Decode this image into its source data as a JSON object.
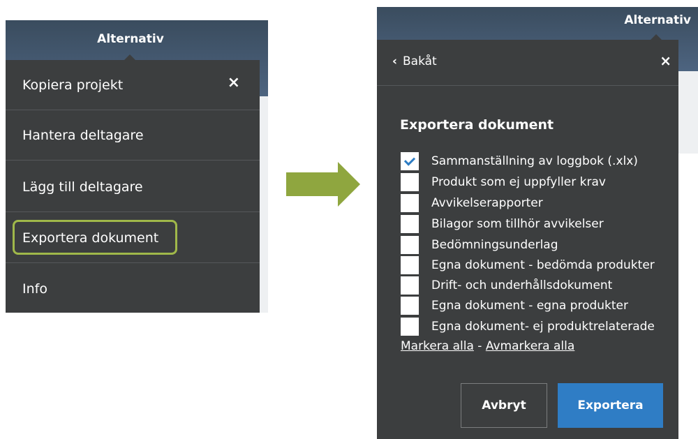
{
  "left": {
    "header_title": "Alternativ",
    "close_glyph": "×",
    "menu_items": [
      {
        "label": "Kopiera projekt"
      },
      {
        "label": "Hantera deltagare"
      },
      {
        "label": "Lägg till deltagare"
      },
      {
        "label": "Exportera dokument",
        "highlighted": true
      },
      {
        "label": "Info"
      }
    ]
  },
  "arrow": {
    "color": "#8fa63f"
  },
  "right": {
    "header_title": "Alternativ",
    "back_chevron": "‹",
    "back_label": "Bakåt",
    "close_glyph": "×",
    "section_title": "Exportera dokument",
    "options": [
      {
        "label": "Sammanställning av loggbok (.xlx)",
        "checked": true
      },
      {
        "label": "Produkt som ej uppfyller krav",
        "checked": false
      },
      {
        "label": "Avvikelserapporter",
        "checked": false
      },
      {
        "label": "Bilagor som tillhör avvikelser",
        "checked": false
      },
      {
        "label": "Bedömningsunderlag",
        "checked": false
      },
      {
        "label": "Egna dokument - bedömda produkter",
        "checked": false
      },
      {
        "label": "Drift- och underhållsdokument",
        "checked": false
      },
      {
        "label": "Egna dokument - egna produkter",
        "checked": false
      },
      {
        "label": "Egna dokument- ej produktrelaterade",
        "checked": false
      }
    ],
    "select_all": "Markera alla",
    "separator": " - ",
    "deselect_all": "Avmarkera alla",
    "cancel_label": "Avbryt",
    "export_label": "Exportera"
  },
  "colors": {
    "header_blue": "#4d6480",
    "panel_dark": "#3c3e3f",
    "highlight_green": "#a0b84a",
    "primary_blue": "#2f7dc5",
    "checkmark_blue": "#2d7cc3"
  }
}
